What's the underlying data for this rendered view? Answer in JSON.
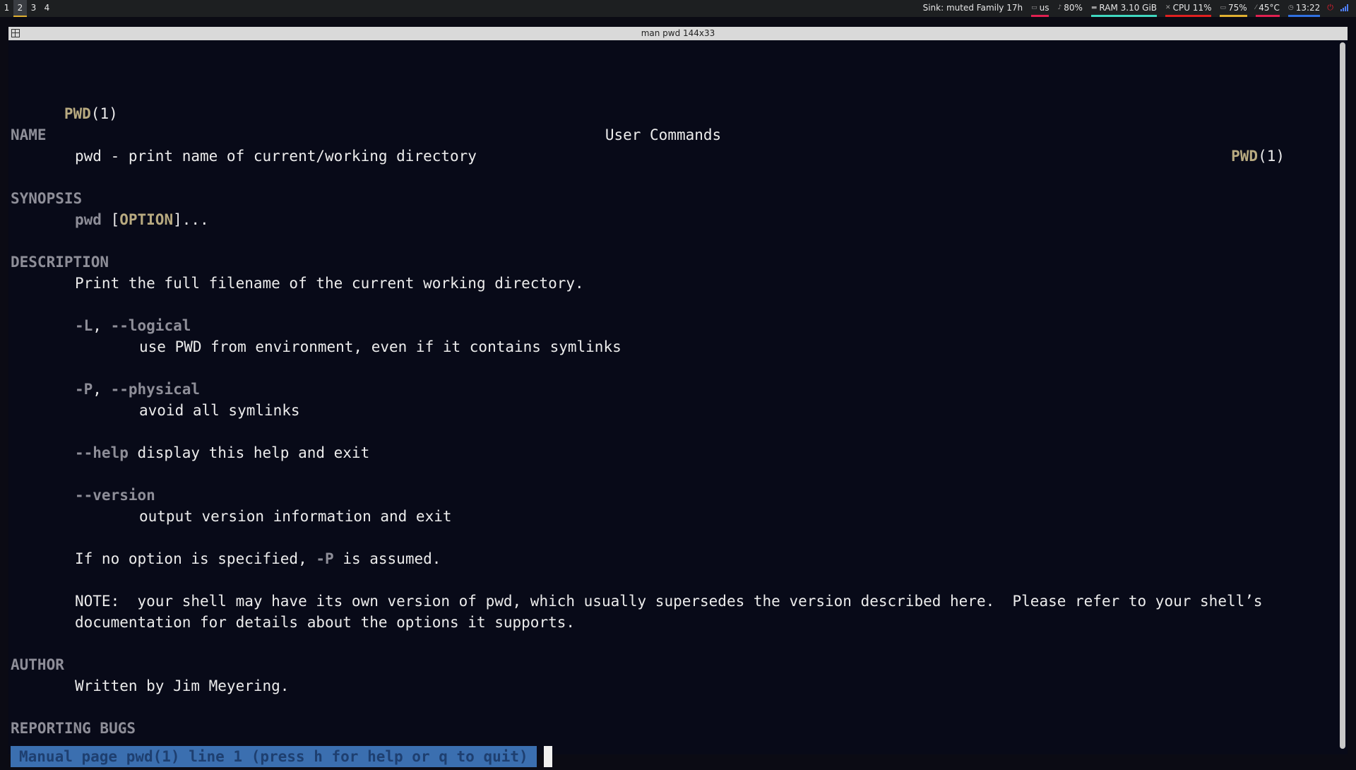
{
  "topbar": {
    "workspaces": [
      "1",
      "2",
      "3",
      "4"
    ],
    "active_workspace": "2",
    "sink": "Sink: muted Family 17h",
    "keyboard": "us",
    "volume": "80%",
    "ram": "RAM 3.10 GiB",
    "cpu": "CPU 11%",
    "battery": "75%",
    "temperature": "45°C",
    "time": "13:22"
  },
  "window": {
    "title": "man pwd 144x33"
  },
  "man": {
    "header_left": "PWD",
    "header_left_num": "(1)",
    "header_center": "User Commands",
    "header_right": "PWD",
    "header_right_num": "(1)",
    "name_heading": "NAME",
    "name_text": "pwd - print name of current/working directory",
    "synopsis_heading": "SYNOPSIS",
    "synopsis_cmd": "pwd",
    "synopsis_open": " [",
    "synopsis_opt": "OPTION",
    "synopsis_close": "]...",
    "description_heading": "DESCRIPTION",
    "description_text": "Print the full filename of the current working directory.",
    "opt_L": "-L",
    "opt_L_sep": ", ",
    "opt_L_long": "--logical",
    "opt_L_desc": "use PWD from environment, even if it contains symlinks",
    "opt_P": "-P",
    "opt_P_sep": ", ",
    "opt_P_long": "--physical",
    "opt_P_desc": "avoid all symlinks",
    "opt_help": "--help",
    "opt_help_desc": " display this help and exit",
    "opt_version": "--version",
    "opt_version_desc": "output version information and exit",
    "default_pre": "If no option is specified, ",
    "default_opt": "-P",
    "default_post": " is assumed.",
    "note_line1": "NOTE:  your shell may have its own version of pwd, which usually supersedes the version described here.  Please refer to your shell’s",
    "note_line2": "documentation for details about the options it supports.",
    "author_heading": "AUTHOR",
    "author_text": "Written by Jim Meyering.",
    "bugs_heading": "REPORTING BUGS",
    "prompt": "Manual page pwd(1) line 1 (press h for help or q to quit)"
  },
  "colors": {
    "background": "#080a18",
    "bold": "#b8aa80",
    "heading": "#8e8e98",
    "prompt_bg": "#3b6fb0"
  }
}
